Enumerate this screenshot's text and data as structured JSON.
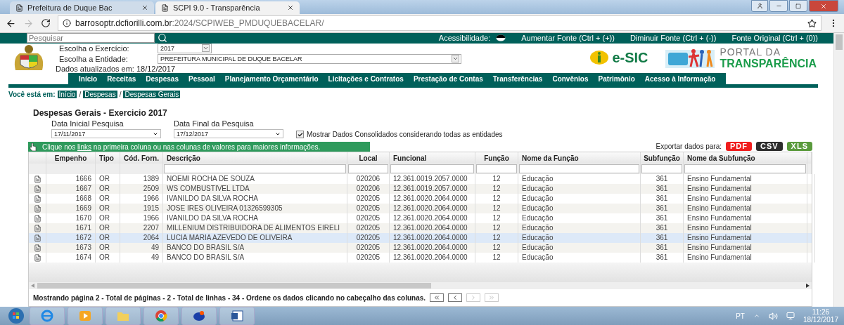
{
  "browser": {
    "tabs": [
      {
        "title": "Prefeitura de Duque Bac",
        "selected": false
      },
      {
        "title": "SCPI 9.0 - Transparência",
        "selected": true
      }
    ],
    "url_host": "barrosoptr.dcfiorilli.com.br",
    "url_path": ":2024/SCPIWEB_PMDUQUEBACELAR/"
  },
  "topbar": {
    "search_placeholder": "Pesquisar",
    "accessibility_label": "Acessibilidade:",
    "links": [
      "Aumentar Fonte (Ctrl + (+))",
      "Diminuir Fonte (Ctrl + (-))",
      "Fonte Original (Ctrl + (0))"
    ]
  },
  "header": {
    "exercise_label": "Escolha o Exercício:",
    "exercise_value": "2017",
    "entity_label": "Escolha a Entidade:",
    "entity_value": "PREFEITURA MUNICIPAL DE DUQUE BACELAR",
    "updated": "Dados atualizados em: 18/12/2017",
    "esic": "e-SIC",
    "portal_line1": "PORTAL DA",
    "portal_line2": "TRANSPARÊNCIA"
  },
  "nav": [
    "Início",
    "Receitas",
    "Despesas",
    "Pessoal",
    "Planejamento Orçamentário",
    "Licitações e Contratos",
    "Prestação de Contas",
    "Transferências",
    "Convênios",
    "Patrimônio",
    "Acesso à Informação"
  ],
  "breadcrumb": {
    "label": "Você está em:",
    "items": [
      "Início",
      "Despesas",
      "Despesas Gerais"
    ],
    "separator": "/"
  },
  "page": {
    "title": "Despesas Gerais - Exercicio 2017",
    "date_start_label": "Data Inicial Pesquisa",
    "date_start": "17/11/2017",
    "date_end_label": "Data Final da Pesquisa",
    "date_end": "17/12/2017",
    "consolidated": {
      "label": "Mostrar Dados Consolidados considerando todas as entidades",
      "checked": true
    },
    "info_before": "Clique nos ",
    "info_link": "links",
    "info_after": " na primeira coluna ou nas colunas de valores para maiores informações.",
    "export_label": "Exportar dados para:",
    "exports": [
      {
        "label": "PDF",
        "kind": "pdf"
      },
      {
        "label": "CSV",
        "kind": "csv"
      },
      {
        "label": "XLS",
        "kind": "xls"
      }
    ]
  },
  "table": {
    "columns": [
      {
        "label": "Empenho",
        "filter": false
      },
      {
        "label": "Tipo",
        "filter": false
      },
      {
        "label": "Cód. Forn.",
        "filter": false
      },
      {
        "label": "Descrição",
        "filter": true
      },
      {
        "label": "Local",
        "filter": true
      },
      {
        "label": "Funcional",
        "filter": true
      },
      {
        "label": "Função",
        "filter": true
      },
      {
        "label": "Nome da Função",
        "filter": true
      },
      {
        "label": "Subfunção",
        "filter": true
      },
      {
        "label": "Nome da Subfunção",
        "filter": true
      }
    ],
    "rows": [
      {
        "selected": false,
        "cells": [
          "1666",
          "OR",
          "1389",
          "NOEMI ROCHA DE SOUZA",
          "020206",
          "12.361.0019.2057.0000",
          "12",
          "Educação",
          "361",
          "Ensino Fundamental"
        ]
      },
      {
        "selected": false,
        "cells": [
          "1667",
          "OR",
          "2509",
          "WS COMBUSTIVEL LTDA",
          "020206",
          "12.361.0019.2057.0000",
          "12",
          "Educação",
          "361",
          "Ensino Fundamental"
        ]
      },
      {
        "selected": false,
        "cells": [
          "1668",
          "OR",
          "1966",
          "IVANILDO DA SILVA ROCHA",
          "020205",
          "12.361.0020.2064.0000",
          "12",
          "Educação",
          "361",
          "Ensino Fundamental"
        ]
      },
      {
        "selected": false,
        "cells": [
          "1669",
          "OR",
          "1915",
          "JOSE IRES OLIVEIRA 01326599305",
          "020205",
          "12.361.0020.2064.0000",
          "12",
          "Educação",
          "361",
          "Ensino Fundamental"
        ]
      },
      {
        "selected": false,
        "cells": [
          "1670",
          "OR",
          "1966",
          "IVANILDO DA SILVA ROCHA",
          "020205",
          "12.361.0020.2064.0000",
          "12",
          "Educação",
          "361",
          "Ensino Fundamental"
        ]
      },
      {
        "selected": false,
        "cells": [
          "1671",
          "OR",
          "2207",
          "MILLENIUM DISTRIBUIDORA DE ALIMENTOS EIRELI",
          "020205",
          "12.361.0020.2064.0000",
          "12",
          "Educação",
          "361",
          "Ensino Fundamental"
        ]
      },
      {
        "selected": true,
        "cells": [
          "1672",
          "OR",
          "2064",
          "LUCIA MARIA AZEVEDO DE OLIVEIRA",
          "020205",
          "12.361.0020.2064.0000",
          "12",
          "Educação",
          "361",
          "Ensino Fundamental"
        ]
      },
      {
        "selected": false,
        "cells": [
          "1673",
          "OR",
          "49",
          "BANCO DO BRASIL S/A",
          "020205",
          "12.361.0020.2064.0000",
          "12",
          "Educação",
          "361",
          "Ensino Fundamental"
        ]
      },
      {
        "selected": false,
        "cells": [
          "1674",
          "OR",
          "49",
          "BANCO DO BRASIL S/A",
          "020205",
          "12.361.0020.2064.0000",
          "12",
          "Educação",
          "361",
          "Ensino Fundamental"
        ]
      }
    ],
    "footer": "Mostrando página 2 - Total de páginas - 2 - Total de linhas - 34 - Ordene os dados clicando no cabeçalho das colunas.",
    "pager": [
      {
        "kind": "first",
        "disabled": false
      },
      {
        "kind": "prev",
        "disabled": false
      },
      {
        "kind": "next",
        "disabled": true
      },
      {
        "kind": "last",
        "disabled": true
      }
    ]
  },
  "taskbar": {
    "language": "PT",
    "time": "11:26",
    "date": "18/12/2017"
  }
}
